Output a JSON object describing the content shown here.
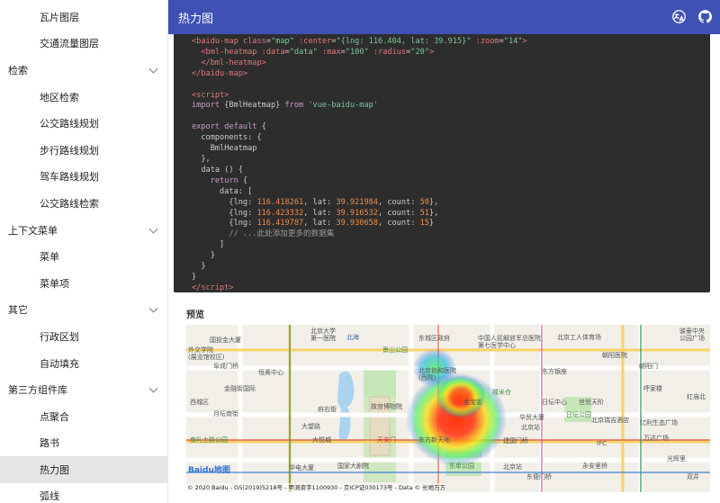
{
  "sidebar": {
    "items": [
      {
        "label": "瓦片图层",
        "kind": "child"
      },
      {
        "label": "交通流量图层",
        "kind": "child"
      },
      {
        "label": "检索",
        "kind": "group"
      },
      {
        "label": "地区检索",
        "kind": "child"
      },
      {
        "label": "公交路线规划",
        "kind": "child"
      },
      {
        "label": "步行路线规划",
        "kind": "child"
      },
      {
        "label": "驾车路线规划",
        "kind": "child"
      },
      {
        "label": "公交路线检索",
        "kind": "child"
      },
      {
        "label": "上下文菜单",
        "kind": "group"
      },
      {
        "label": "菜单",
        "kind": "child"
      },
      {
        "label": "菜单项",
        "kind": "child"
      },
      {
        "label": "其它",
        "kind": "group"
      },
      {
        "label": "行政区划",
        "kind": "child"
      },
      {
        "label": "自动填充",
        "kind": "child"
      },
      {
        "label": "第三方组件库",
        "kind": "group"
      },
      {
        "label": "点聚合",
        "kind": "child"
      },
      {
        "label": "路书",
        "kind": "child"
      },
      {
        "label": "热力图",
        "kind": "child",
        "active": true
      },
      {
        "label": "弧线",
        "kind": "child"
      }
    ]
  },
  "header": {
    "title": "热力图",
    "icons": [
      "translate-icon",
      "github-icon"
    ]
  },
  "main": {
    "preview_label": "预览"
  },
  "map": {
    "pois": [
      {
        "text": "北京大学\n第一医院",
        "color": "plain"
      },
      {
        "text": "北海",
        "color": "blue"
      },
      {
        "text": "东城区政府",
        "color": "plain"
      },
      {
        "text": "中国人民解放军总医院\n第七医学中心",
        "color": "plain"
      },
      {
        "text": "北京工人体育场",
        "color": "plain"
      },
      {
        "text": "骏豪中央\n公园广场",
        "color": "plain"
      },
      {
        "text": "外交学院\n(展览馆校区)",
        "color": "plain"
      },
      {
        "text": "阜成门桥",
        "color": "plain"
      },
      {
        "text": "国投金大厦",
        "color": "plain"
      },
      {
        "text": "恒奥中心",
        "color": "plain"
      },
      {
        "text": "景山公园",
        "color": "green"
      },
      {
        "text": "北京协和医院\n(西院)",
        "color": "plain"
      },
      {
        "text": "东方银座",
        "color": "plain"
      },
      {
        "text": "日坛中心",
        "color": "plain"
      },
      {
        "text": "朝阳医院",
        "color": "plain"
      },
      {
        "text": "朝阳门",
        "color": "plain"
      },
      {
        "text": "金融街国际",
        "color": "plain"
      },
      {
        "text": "禄米仓",
        "color": "green"
      },
      {
        "text": "世贸天阶",
        "color": "plain"
      },
      {
        "text": "呼家楼",
        "color": "plain"
      },
      {
        "text": "红庙北",
        "color": "plain"
      },
      {
        "text": "故宫博物院",
        "color": "plain"
      },
      {
        "text": "西城区",
        "color": "plain"
      },
      {
        "text": "府右街",
        "color": "plain"
      },
      {
        "text": "金宝街",
        "color": "plain"
      },
      {
        "text": "北京站",
        "color": "plain"
      },
      {
        "text": "日坛公园",
        "color": "green"
      },
      {
        "text": "月坛南街",
        "color": "plain"
      },
      {
        "text": "华贸大厦",
        "color": "plain"
      },
      {
        "text": "北京瑞吉酒店",
        "color": "plain"
      },
      {
        "text": "大望路",
        "color": "plain"
      },
      {
        "text": "亿利生态广场",
        "color": "plain"
      },
      {
        "text": "南礼士路公园",
        "color": "green"
      },
      {
        "text": "大悦城",
        "color": "plain"
      },
      {
        "text": "万达广场",
        "color": "plain"
      },
      {
        "text": "天安门",
        "color": "red"
      },
      {
        "text": "东方新天地",
        "color": "plain"
      },
      {
        "text": "建国门桥",
        "color": "plain"
      },
      {
        "text": "IFC",
        "color": "plain"
      },
      {
        "text": "华电大厦",
        "color": "plain"
      },
      {
        "text": "国家大剧院",
        "color": "plain"
      },
      {
        "text": "东单公园",
        "color": "green"
      },
      {
        "text": "北京站",
        "color": "plain"
      },
      {
        "text": "永安里桥",
        "color": "plain"
      },
      {
        "text": "光辉里",
        "color": "plain"
      },
      {
        "text": "东便门桥",
        "color": "plain"
      },
      {
        "text": "双井",
        "color": "plain"
      }
    ],
    "logo": "Baidu地图",
    "copyright": "© 2020 Baidu - GS(2019)5218号 - 甲测资字1100930 - 京ICP证030173号 - Data © 长地万方"
  }
}
